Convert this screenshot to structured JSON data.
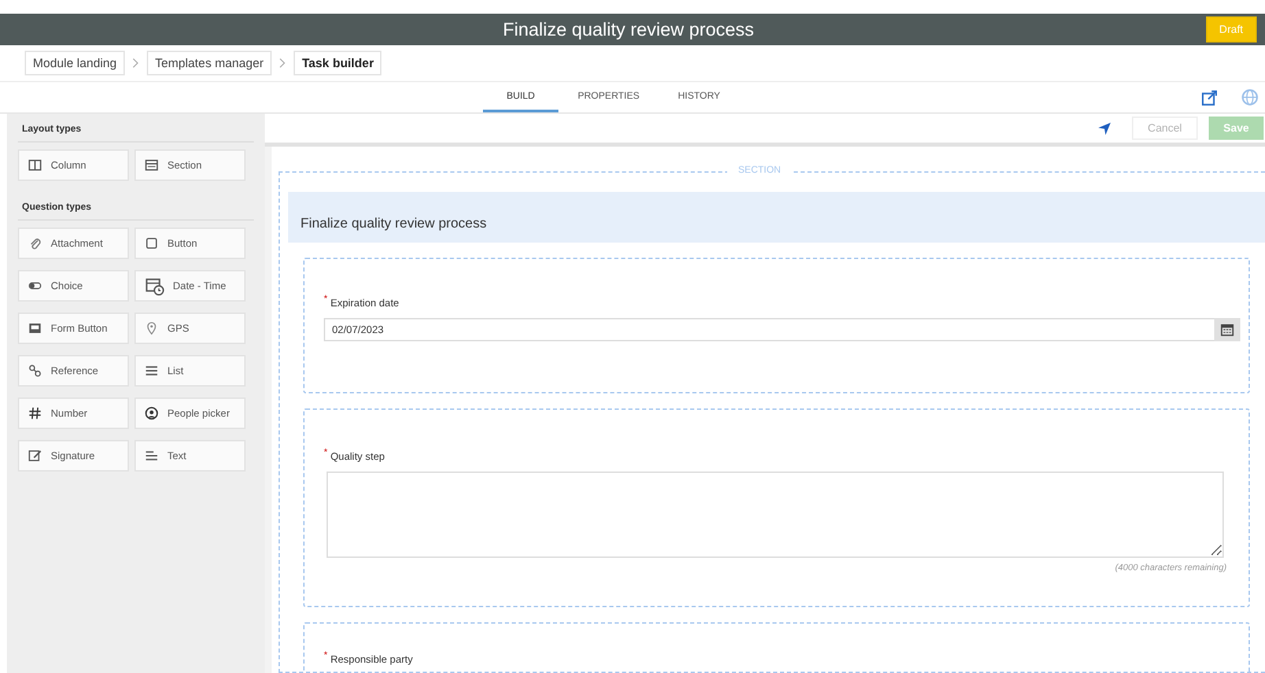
{
  "window": {
    "title": "Finalize quality review process",
    "status_badge": "Draft"
  },
  "breadcrumbs": [
    {
      "label": "Module landing",
      "current": false
    },
    {
      "label": "Templates manager",
      "current": false
    },
    {
      "label": "Task builder",
      "current": true
    }
  ],
  "tabs": [
    {
      "label": "BUILD",
      "selected": true
    },
    {
      "label": "PROPERTIES",
      "selected": false
    },
    {
      "label": "HISTORY",
      "selected": false
    }
  ],
  "toolbar": {
    "buttons": [
      {
        "label": "Cancel",
        "kind": "secondary",
        "disabled": true
      },
      {
        "label": "Save",
        "kind": "primary",
        "disabled": true
      }
    ]
  },
  "palette": {
    "groups": [
      {
        "title": "Layout types",
        "items": [
          {
            "label": "Column",
            "kind": "column"
          },
          {
            "label": "Section",
            "kind": "section"
          }
        ]
      },
      {
        "title": "Question types",
        "items": [
          {
            "label": "Attachment",
            "kind": "attachment"
          },
          {
            "label": "Button",
            "kind": "button"
          },
          {
            "label": "Choice",
            "kind": "choice"
          },
          {
            "label": "Date - Time",
            "kind": "datetime"
          },
          {
            "label": "Form Button",
            "kind": "form"
          },
          {
            "label": "GPS",
            "kind": "gps"
          },
          {
            "label": "Reference",
            "kind": "reference"
          },
          {
            "label": "List",
            "kind": "list"
          },
          {
            "label": "Number",
            "kind": "number"
          },
          {
            "label": "People picker",
            "kind": "person"
          },
          {
            "label": "Signature",
            "kind": "signature"
          },
          {
            "label": "Text",
            "kind": "text"
          }
        ]
      }
    ]
  },
  "form": {
    "section_label": "SECTION",
    "title": "Finalize quality review process",
    "fields": [
      {
        "kind": "date",
        "label": "$^{*}$ Expiration date",
        "value": "02/07/2023"
      },
      {
        "kind": "textarea",
        "label": "$^{*}$ Quality step",
        "counter": "(4000 characters remaining)"
      },
      {
        "kind": "text",
        "label": "$^{*}$ Responsible party"
      }
    ]
  }
}
